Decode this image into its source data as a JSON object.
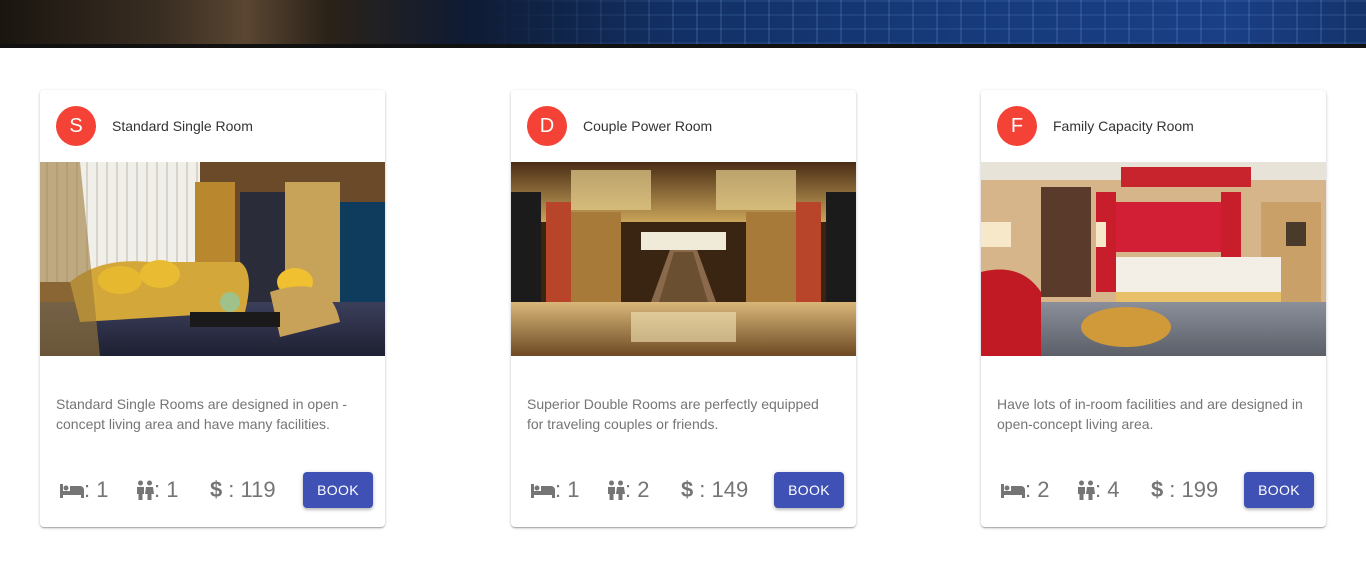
{
  "colors": {
    "avatar": "#f44336",
    "button": "#3f51b5",
    "muted_text": "#757575"
  },
  "rooms": [
    {
      "avatar_letter": "S",
      "title": "Standard Single Room",
      "description": "Standard Single Rooms are designed in open -concept living area and have many facilities.",
      "beds": ": 1",
      "people": ": 1",
      "price": ": 119",
      "price_symbol": "$",
      "book_label": "BOOK",
      "icons": [
        "bed-icon",
        "people-icon",
        "dollar-icon"
      ]
    },
    {
      "avatar_letter": "D",
      "title": "Couple Power Room",
      "description": "Superior Double Rooms are perfectly equipped for traveling couples or friends.",
      "beds": ": 1",
      "people": ": 2",
      "price": ": 149",
      "price_symbol": "$",
      "book_label": "BOOK",
      "icons": [
        "bed-icon",
        "people-icon",
        "dollar-icon"
      ]
    },
    {
      "avatar_letter": "F",
      "title": "Family Capacity Room",
      "description": "Have lots of in-room facilities and are designed in open-concept living area.",
      "beds": ": 2",
      "people": ": 4",
      "price": ": 199",
      "price_symbol": "$",
      "book_label": "BOOK",
      "icons": [
        "bed-icon",
        "people-icon",
        "dollar-icon"
      ]
    }
  ]
}
